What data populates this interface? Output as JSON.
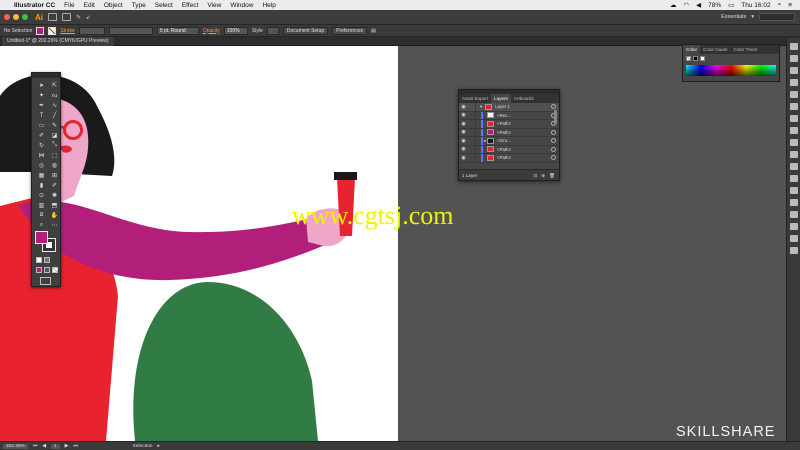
{
  "menubar": {
    "app_name": "Illustrator CC",
    "items": [
      "File",
      "Edit",
      "Object",
      "Type",
      "Select",
      "Effect",
      "View",
      "Window",
      "Help"
    ],
    "battery": "78%",
    "clock": "Thu 16:02"
  },
  "appbar": {
    "logo": "Ai",
    "workspace": "Essentials"
  },
  "controlbar": {
    "selection_label": "No Selection",
    "stroke_label": "Stroke",
    "brush_value": "5 pt. Round",
    "opacity_label": "Opacity",
    "opacity_value": "100%",
    "style_label": "Style",
    "document_setup": "Document Setup",
    "preferences": "Preferences"
  },
  "document": {
    "tab_title": "Untitled-1* @ 202.26% (CMYK/GPU Preview)"
  },
  "tools": {
    "fill_color": "#b31e79",
    "stroke_color": "#ffffff"
  },
  "layers_panel": {
    "tabs": [
      "Asset Export",
      "Layers",
      "Artboards"
    ],
    "active_tab": "Layers",
    "layer_name": "Layer 1",
    "items": [
      "<Rec...",
      "<Path>",
      "<Path>",
      "<Gro...",
      "<Path>",
      "<Path>"
    ],
    "footer": "1 Layer"
  },
  "color_panel": {
    "tabs": [
      "Color",
      "Color Guide",
      "Color Them"
    ],
    "active_tab": "Color"
  },
  "statusbar": {
    "zoom": "202.26%",
    "page": "1",
    "tool": "Selection"
  },
  "overlays": {
    "watermark": "www.cgtsj.com",
    "brand": "SKILLSHARE"
  },
  "colors": {
    "accent_orange": "#ff9a00",
    "artwork_red": "#e8232f",
    "artwork_magenta": "#b21f7a",
    "artwork_green": "#317b45",
    "artwork_pink": "#f0a6c9",
    "artwork_black": "#1a1a1a",
    "layer_color": "#4a7cff"
  }
}
